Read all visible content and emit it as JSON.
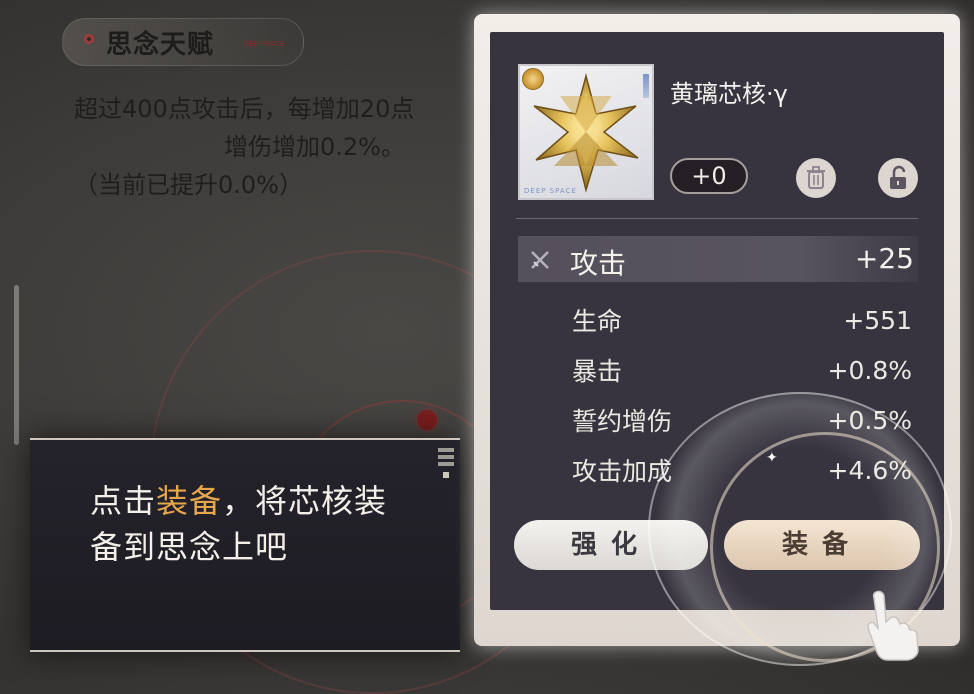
{
  "talent": {
    "title": "思念天赋",
    "deco_text": "DEEPSPACE",
    "description": "超过400点攻击后，每增加20点",
    "description_tail": "增伤增加0.2%。",
    "progress": "（当前已提升0.0%）"
  },
  "tutorial": {
    "text_prefix": "点击",
    "text_highlight": "装备",
    "text_suffix": "，将芯核装备到思念上吧"
  },
  "item": {
    "name": "黄璃芯核·γ",
    "level": "+0",
    "thumb_label": "DEEP SPACE"
  },
  "main_stat": {
    "name": "攻击",
    "value": "+25"
  },
  "sub_stats": [
    {
      "name": "生命",
      "value": "+551"
    },
    {
      "name": "暴击",
      "value": "+0.8%"
    },
    {
      "name": "誓约增伤",
      "value": "+0.5%"
    },
    {
      "name": "攻击加成",
      "value": "+4.6%"
    }
  ],
  "buttons": {
    "upgrade": "强化",
    "equip": "装备"
  },
  "colors": {
    "highlight": "#e6a64c",
    "card_bg": "#37343f",
    "accent_red": "#a23a38"
  },
  "icons": {
    "trash": "trash-icon",
    "lock": "lock-open-icon",
    "attack": "crossed-swords-icon",
    "pointer": "hand-pointer-icon"
  }
}
